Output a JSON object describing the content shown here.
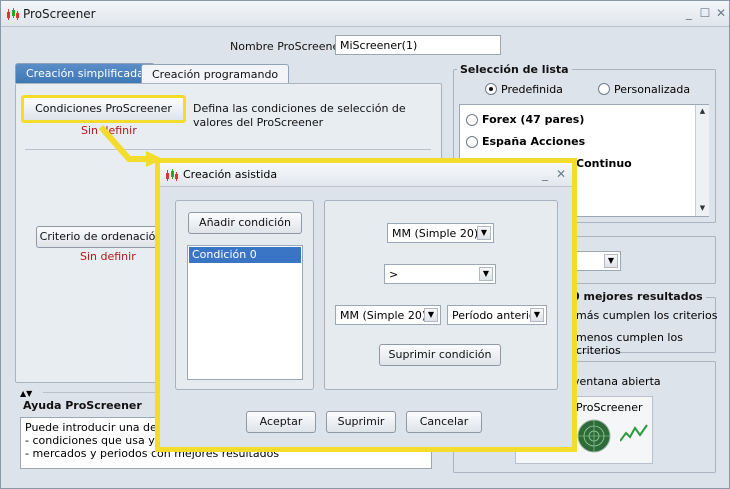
{
  "window": {
    "title": "ProScreener",
    "minimize": "_",
    "maximize": "☐",
    "close": "✕"
  },
  "name_field": {
    "label": "Nombre ProScreener",
    "value": "MiScreener(1)"
  },
  "tabs": [
    {
      "label": "Creación simplificada"
    },
    {
      "label": "Creación programando"
    }
  ],
  "simplified": {
    "conditions_button": "Condiciones ProScreener",
    "conditions_description": "Defina las condiciones de selección de valores del ProScreener",
    "conditions_status": "Sin definir",
    "sort_button": "Criterio de ordenación",
    "sort_status": "Sin definir"
  },
  "list_selection": {
    "title": "Selección de lista",
    "options": [
      {
        "label": "Predefinida",
        "selected": true
      },
      {
        "label": "Personalizada",
        "selected": false
      }
    ],
    "items": [
      "Forex (47 pares)",
      "España Acciones",
      "Continuo"
    ]
  },
  "results": {
    "title_partial": "0 mejores resultados",
    "line1": "más cumplen los criterios",
    "line2": "menos cumplen los criterios"
  },
  "window_option": {
    "label_partial": "ventana abierta",
    "preview_title": "ProScreener"
  },
  "help": {
    "title": "Ayuda ProScreener",
    "lines": [
      "Puede introducir una descri",
      "- condiciones que usa y cla",
      "- mercados y periodos con mejores resultados"
    ]
  },
  "dialog": {
    "title": "Creación asistida",
    "add_condition": "Añadir condición",
    "conditions": [
      "Condición 0"
    ],
    "combo1": "MM (Simple 20)",
    "combo2": ">",
    "combo3": "MM (Simple 20)",
    "combo4": "Período anterior",
    "delete_condition": "Suprimir condición",
    "accept": "Aceptar",
    "delete": "Suprimir",
    "cancel": "Cancelar"
  },
  "colors": {
    "accent_tab": "#4a82c0",
    "highlight": "#f3dc2c",
    "status_red": "#b01818",
    "selection": "#3a74c4"
  },
  "icons": [
    "candlestick-app-icon",
    "radar-icon",
    "dropdown-arrow-icon",
    "scroll-up-icon",
    "scroll-down-icon"
  ]
}
